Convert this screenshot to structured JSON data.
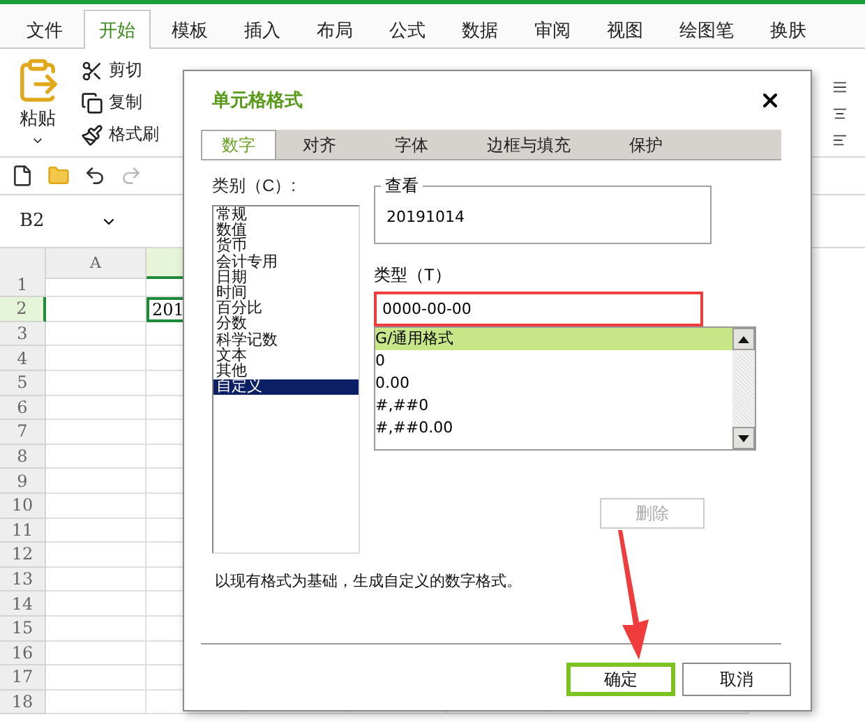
{
  "ribbon_tabs": [
    {
      "label": "文件",
      "selected": false
    },
    {
      "label": "开始",
      "selected": true
    },
    {
      "label": "模板",
      "selected": false
    },
    {
      "label": "插入",
      "selected": false
    },
    {
      "label": "布局",
      "selected": false
    },
    {
      "label": "公式",
      "selected": false
    },
    {
      "label": "数据",
      "selected": false
    },
    {
      "label": "审阅",
      "selected": false
    },
    {
      "label": "视图",
      "selected": false
    },
    {
      "label": "绘图笔",
      "selected": false
    },
    {
      "label": "换肤",
      "selected": false
    }
  ],
  "clipboard": {
    "paste": "粘贴",
    "cut": "剪切",
    "copy": "复制",
    "format_painter": "格式刷"
  },
  "name_box": "B2",
  "sheet": {
    "columns": [
      {
        "label": "A",
        "selected": false
      },
      {
        "selected": true
      }
    ],
    "rows": [
      {
        "label": "1",
        "selected": false
      },
      {
        "label": "2",
        "selected": true
      },
      {
        "label": "3",
        "selected": false
      },
      {
        "label": "4",
        "selected": false
      },
      {
        "label": "5",
        "selected": false
      },
      {
        "label": "6",
        "selected": false
      },
      {
        "label": "7",
        "selected": false
      },
      {
        "label": "8",
        "selected": false
      },
      {
        "label": "9",
        "selected": false
      },
      {
        "label": "10",
        "selected": false
      },
      {
        "label": "11",
        "selected": false
      },
      {
        "label": "12",
        "selected": false
      },
      {
        "label": "13",
        "selected": false
      },
      {
        "label": "14",
        "selected": false
      },
      {
        "label": "15",
        "selected": false
      },
      {
        "label": "16",
        "selected": false
      },
      {
        "label": "17",
        "selected": false
      },
      {
        "label": "18",
        "selected": false
      }
    ],
    "active_cell": "201"
  },
  "dialog": {
    "title": "单元格格式",
    "tabs": [
      {
        "label": "数字",
        "selected": true
      },
      {
        "label": "对齐",
        "selected": false
      },
      {
        "label": "字体",
        "selected": false
      },
      {
        "label": "边框与填充",
        "selected": false
      },
      {
        "label": "保护",
        "selected": false
      }
    ],
    "category_label": "类别（C）:",
    "categories": [
      {
        "label": "常规",
        "selected": false
      },
      {
        "label": "数值",
        "selected": false
      },
      {
        "label": "货币",
        "selected": false
      },
      {
        "label": "会计专用",
        "selected": false
      },
      {
        "label": "日期",
        "selected": false
      },
      {
        "label": "时间",
        "selected": false
      },
      {
        "label": "百分比",
        "selected": false
      },
      {
        "label": "分数",
        "selected": false
      },
      {
        "label": "科学记数",
        "selected": false
      },
      {
        "label": "文本",
        "selected": false
      },
      {
        "label": "其他",
        "selected": false
      },
      {
        "label": "自定义",
        "selected": true
      }
    ],
    "preview": {
      "label": "查看",
      "value": "20191014"
    },
    "type_label": "类型（T）",
    "type_value": "0000-00-00",
    "formats": [
      {
        "label": "G/通用格式",
        "selected": true
      },
      {
        "label": "0",
        "selected": false
      },
      {
        "label": "0.00",
        "selected": false
      },
      {
        "label": "#,##0",
        "selected": false
      },
      {
        "label": "#,##0.00",
        "selected": false
      }
    ],
    "delete_button": {
      "label": "删除",
      "disabled": true
    },
    "description": "以现有格式为基础，生成自定义的数字格式。",
    "buttons": [
      {
        "label": "确定",
        "kind": "primary"
      },
      {
        "label": "取消",
        "kind": "secondary"
      }
    ]
  }
}
